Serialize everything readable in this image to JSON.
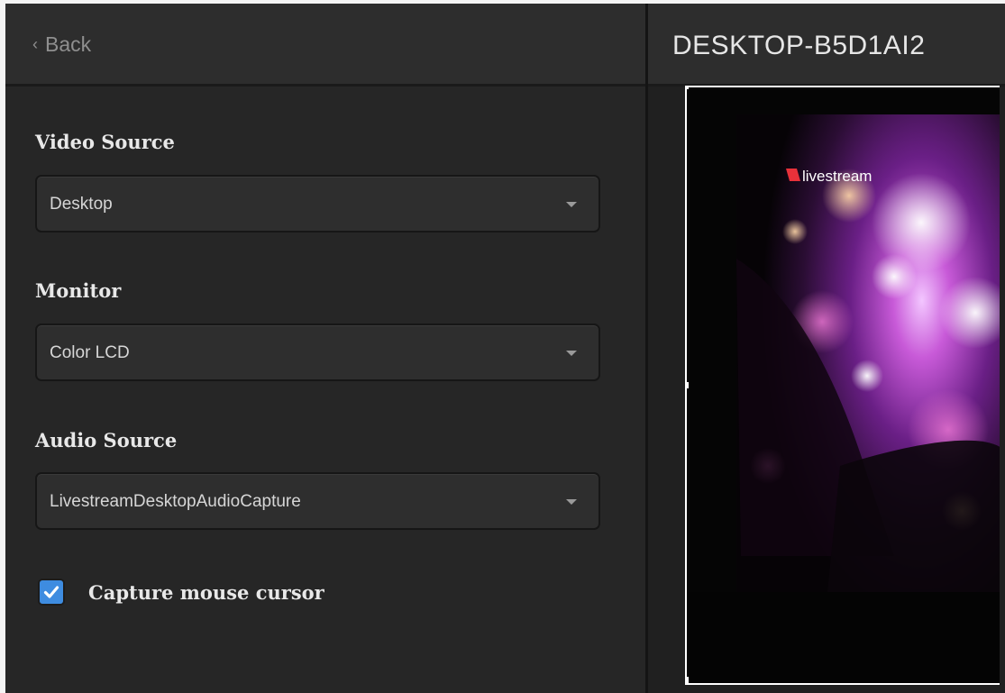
{
  "header": {
    "back_label": "Back",
    "device_title": "DESKTOP-B5D1AI2"
  },
  "form": {
    "video_source": {
      "label": "Video Source",
      "selected": "Desktop"
    },
    "monitor": {
      "label": "Monitor",
      "selected": "Color LCD"
    },
    "audio_source": {
      "label": "Audio Source",
      "selected": "LivestreamDesktopAudioCapture"
    },
    "capture_cursor": {
      "label": "Capture mouse cursor",
      "checked": true
    }
  },
  "preview": {
    "brand_text": "livestream",
    "brand_color": "#e8313a"
  },
  "colors": {
    "accent": "#3e8ce0",
    "panel_bg": "#262626",
    "header_bg": "#2d2d2d"
  }
}
